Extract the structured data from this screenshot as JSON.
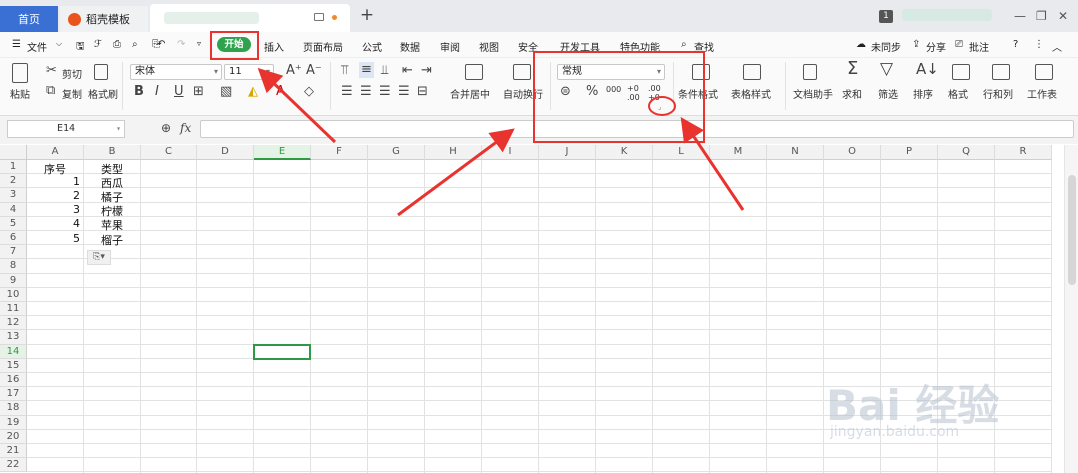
{
  "tabs": {
    "home": "首页",
    "template": "稻壳模板",
    "new_tab": "+"
  },
  "window": {
    "badge": "1"
  },
  "menu": {
    "file": "文件",
    "items": [
      "开始",
      "插入",
      "页面布局",
      "公式",
      "数据",
      "审阅",
      "视图",
      "安全",
      "开发工具",
      "特色功能"
    ],
    "search": "查找",
    "right": [
      "未同步",
      "分享",
      "批注",
      "?"
    ]
  },
  "ribbon": {
    "paste": "粘贴",
    "cut": "剪切",
    "copy": "复制",
    "format_painter": "格式刷",
    "font_name": "宋体",
    "font_size": "11",
    "bold": "B",
    "italic": "I",
    "underline": "U",
    "merge_center": "合并居中",
    "wrap_text": "自动换行",
    "number_format": "常规",
    "percent": "%",
    "thousands": "000",
    "dec_inc": "+0 .00",
    "dec_dec": ".00 +0",
    "conditional_format": "条件格式",
    "table_style": "表格样式",
    "doc_assistant": "文档助手",
    "sum": "求和",
    "filter": "筛选",
    "sort": "排序",
    "format": "格式",
    "rows_cols": "行和列",
    "worksheet": "工作表"
  },
  "formula_bar": {
    "name_box": "E14",
    "fx": "fx",
    "value": ""
  },
  "sheet": {
    "columns": [
      "A",
      "B",
      "C",
      "D",
      "E",
      "F",
      "G",
      "H",
      "I",
      "J",
      "K",
      "L",
      "M",
      "N",
      "O",
      "P",
      "Q",
      "R"
    ],
    "rows": [
      "1",
      "2",
      "3",
      "4",
      "5",
      "6",
      "7",
      "8",
      "9",
      "10",
      "11",
      "12",
      "13",
      "14",
      "15",
      "16",
      "17",
      "18",
      "19",
      "20",
      "21",
      "22"
    ],
    "active_cell": "E14",
    "headers": [
      "序号",
      "类型"
    ],
    "data": [
      [
        "1",
        "西瓜"
      ],
      [
        "2",
        "橘子"
      ],
      [
        "3",
        "柠檬"
      ],
      [
        "4",
        "苹果"
      ],
      [
        "5",
        "榴子"
      ]
    ]
  },
  "watermark": {
    "brand": "Bai 经验",
    "url": "jingyan.baidu.com"
  },
  "colors": {
    "accent_green": "#2fa24d",
    "home_tab_blue": "#3a6fd3",
    "annotation_red": "#e8332f"
  }
}
